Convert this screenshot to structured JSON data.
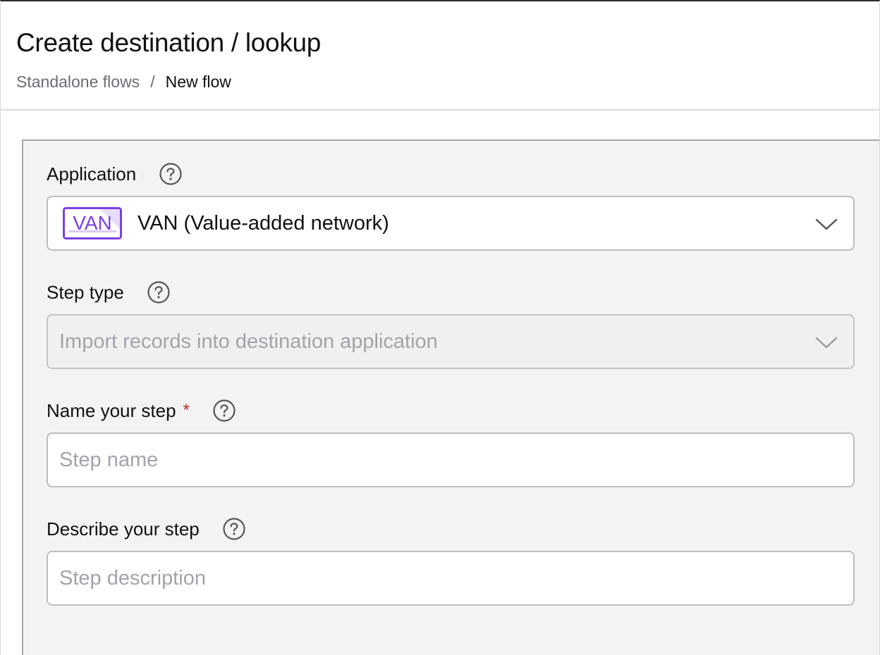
{
  "header": {
    "title": "Create destination / lookup",
    "breadcrumb": {
      "parent": "Standalone flows",
      "separator": "/",
      "current": "New flow"
    }
  },
  "form": {
    "application": {
      "label": "Application",
      "help_icon": "question-circle-icon",
      "logo_text": "VAN",
      "value": "VAN (Value-added network)"
    },
    "step_type": {
      "label": "Step type",
      "help_icon": "question-circle-icon",
      "value": "Import records into destination application",
      "disabled": true
    },
    "step_name": {
      "label": "Name your step",
      "required_marker": "*",
      "help_icon": "question-circle-icon",
      "placeholder": "Step name",
      "value": ""
    },
    "step_description": {
      "label": "Describe your step",
      "help_icon": "question-circle-icon",
      "placeholder": "Step description",
      "value": ""
    }
  },
  "colors": {
    "brand_purple": "#7b3fe4",
    "required_red": "#c62828",
    "panel_bg": "#f3f3f3"
  }
}
